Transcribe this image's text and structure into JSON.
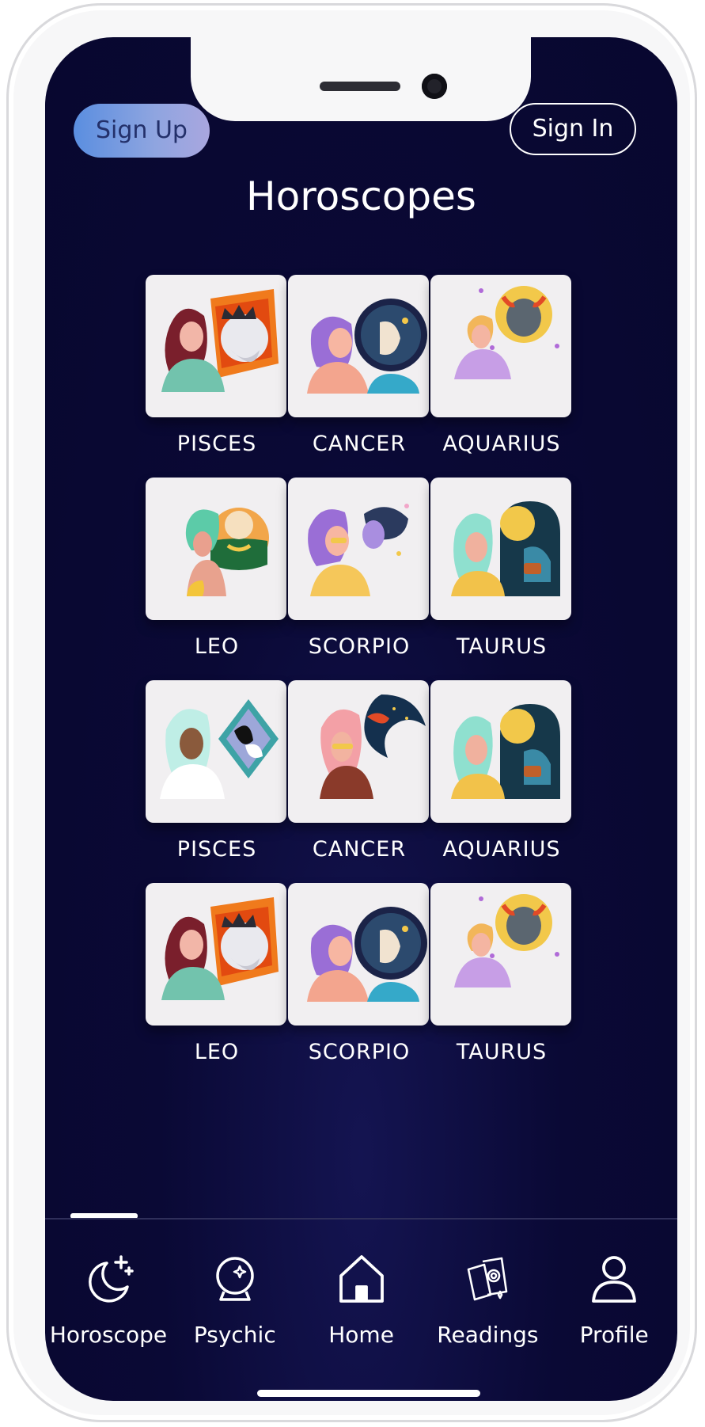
{
  "header": {
    "sign_up_label": "Sign Up",
    "sign_in_label": "Sign In",
    "title": "Horoscopes"
  },
  "signs": [
    {
      "label": "PISCES",
      "art": "lion-portrait"
    },
    {
      "label": "CANCER",
      "art": "twins-portrait"
    },
    {
      "label": "AQUARIUS",
      "art": "bull-portrait"
    },
    {
      "label": "LEO",
      "art": "crab-green-portrait"
    },
    {
      "label": "SCORPIO",
      "art": "dreamer-portrait"
    },
    {
      "label": "TAURUS",
      "art": "arch-sun-portrait"
    },
    {
      "label": "PISCES",
      "art": "fish-portrait"
    },
    {
      "label": "CANCER",
      "art": "crab-moon-portrait"
    },
    {
      "label": "AQUARIUS",
      "art": "arch-sun-portrait"
    },
    {
      "label": "LEO",
      "art": "lion-portrait"
    },
    {
      "label": "SCORPIO",
      "art": "twins-portrait"
    },
    {
      "label": "TAURUS",
      "art": "bull-portrait"
    }
  ],
  "tabs": [
    {
      "label": "Horoscope",
      "icon": "moon-stars-icon",
      "active": true
    },
    {
      "label": "Psychic",
      "icon": "crystal-ball-icon",
      "active": false
    },
    {
      "label": "Home",
      "icon": "home-icon",
      "active": false
    },
    {
      "label": "Readings",
      "icon": "tarot-cards-icon",
      "active": false
    },
    {
      "label": "Profile",
      "icon": "person-icon",
      "active": false
    }
  ],
  "colors": {
    "background": "#08072f",
    "sign_up_gradient": [
      "#5a8ee0",
      "#a9a6df"
    ],
    "tile": "#f1eff1",
    "text": "#ffffff"
  }
}
